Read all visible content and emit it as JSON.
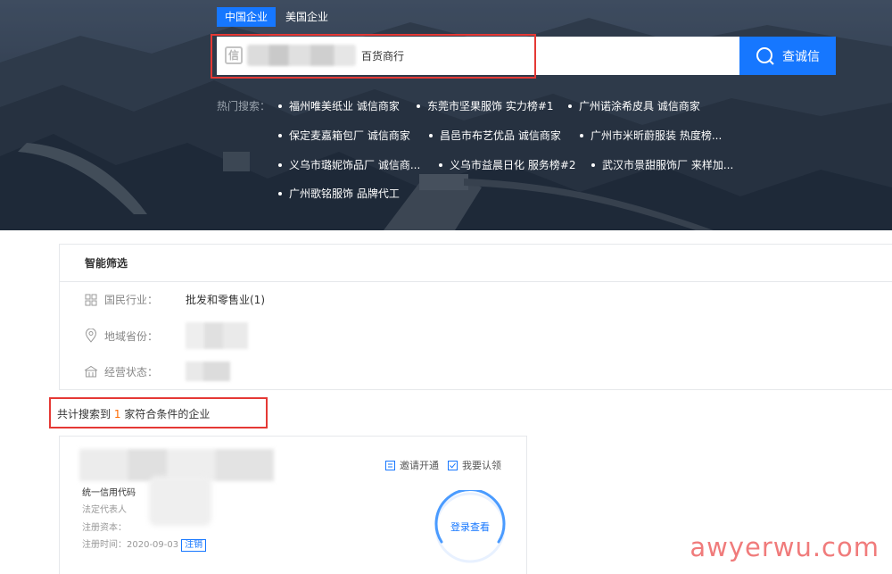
{
  "tabs": [
    {
      "label": "中国企业",
      "active": true
    },
    {
      "label": "美国企业",
      "active": false
    }
  ],
  "search": {
    "value": "百货商行",
    "button_label": "查诚信"
  },
  "hot_search": {
    "label": "热门搜索：",
    "items": [
      "福州唯美纸业 诚信商家",
      "东莞市坚果服饰 实力榜#1",
      "广州诺涂希皮具 诚信商家",
      "保定麦嘉箱包厂 诚信商家",
      "昌邑市布艺优品 诚信商家",
      "广州市米昕蔚服装 热度榜...",
      "义乌市璐妮饰品厂 诚信商...",
      "义乌市益晨日化 服务榜#2",
      "武汉市景甜服饰厂 来样加...",
      "广州歌铭服饰 品牌代工"
    ]
  },
  "filter": {
    "title": "智能筛选",
    "rows": [
      {
        "label": "国民行业：",
        "value": "批发和零售业(1)",
        "icon": "grid-icon"
      },
      {
        "label": "地域省份：",
        "value": "",
        "icon": "location-pin-icon"
      },
      {
        "label": "经营状态：",
        "value": "",
        "icon": "building-icon"
      }
    ]
  },
  "result": {
    "prefix": "共计搜索到",
    "count": "1",
    "suffix": "家符合条件的企业"
  },
  "company": {
    "credit_code_label": "统一信用代码",
    "legal_rep_label": "法定代表人",
    "capital_label": "注册资本：",
    "registered_label": "注册时间：2020-09-03",
    "status": "注销",
    "invite_label": "邀请开通",
    "claim_label": "我要认领",
    "login_label": "登录查看"
  },
  "watermark": "awyerwu.com",
  "colors": {
    "accent": "#1677ff",
    "highlight": "#e53935",
    "count": "#ff6a00"
  }
}
